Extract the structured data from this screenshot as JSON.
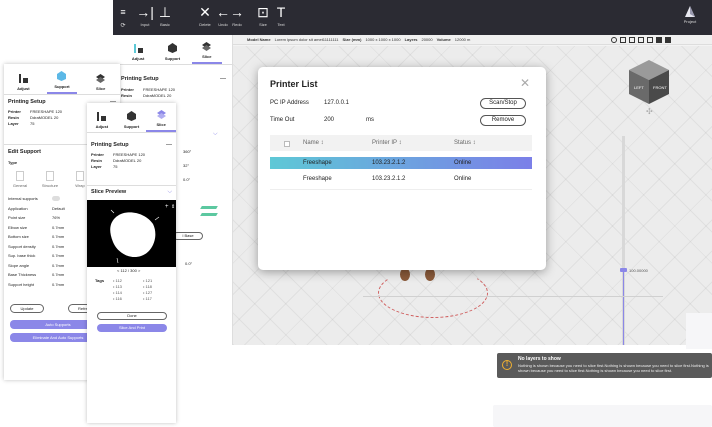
{
  "toolbar": {
    "items": [
      {
        "glyph": "≡",
        "label": ""
      },
      {
        "glyph": "→|",
        "label": "Input"
      },
      {
        "glyph": "⊥",
        "label": "Basic"
      },
      {
        "glyph": "✕",
        "label": "Delete"
      },
      {
        "glyph": "←",
        "label": "Undo"
      },
      {
        "glyph": "→",
        "label": "Redo"
      },
      {
        "glyph": "⊡",
        "label": "Size"
      },
      {
        "glyph": "T",
        "label": "Text"
      }
    ],
    "logo_label": "Project"
  },
  "infobar": {
    "model_name_key": "Model Name",
    "model_name_val": "Lorem ipsum dolor sit amet11111111",
    "size_key": "Size (mm)",
    "size_val": "1000 x 1000 x 1000",
    "layers_key": "Layers",
    "layers_val": "20000",
    "volume_key": "Volume",
    "volume_val": "12000 m"
  },
  "tabs": {
    "adjust": "Adjust",
    "support": "Support",
    "slice": "Slice"
  },
  "printing_setup": {
    "title": "Printing Setup",
    "printer_key": "Printer",
    "printer_val": "FREESHAPE 120",
    "resin_key": "Resin",
    "resin_val": "DdraMODEL 20",
    "layer_key": "Layer",
    "layer_val": "75"
  },
  "main_panel": {
    "rot_vals": [
      "360°",
      "32°",
      "0.0°"
    ],
    "base_label": "l Base",
    "extra_val": "0.0°"
  },
  "edit_support": {
    "title": "Edit Support",
    "type_label": "Type",
    "types": [
      "General",
      "Structure",
      "Wrap"
    ],
    "rows": [
      {
        "k": "Internal supports",
        "v": ""
      },
      {
        "k": "Application",
        "v": "Default"
      },
      {
        "k": "Point size",
        "v": "76%"
      },
      {
        "k": "Elbow size",
        "v": "0.7mm"
      },
      {
        "k": "Bottom size",
        "v": "0.7mm"
      },
      {
        "k": "Support density",
        "v": "0.7mm"
      },
      {
        "k": "Sup. base thick",
        "v": "0.7mm"
      },
      {
        "k": "Slope angle",
        "v": "0.7mm"
      },
      {
        "k": "Base Thickness",
        "v": "0.7mm"
      },
      {
        "k": "Support height",
        "v": "0.7mm"
      }
    ],
    "update_label": "Update",
    "refresh_label": "Refresh",
    "auto_supports_label": "Auto Supports",
    "eliminate_label": "Eliminate And Auto Supports"
  },
  "slice_preview": {
    "title": "Slice Preview",
    "pager": "< 112 / 300 >",
    "tags_label": "Tags",
    "tags": [
      "112",
      "113",
      "114",
      "116",
      "117",
      "118",
      "121",
      "127"
    ],
    "done_label": "Done",
    "slice_print_label": "Slice And Print"
  },
  "dialog": {
    "title": "Printer List",
    "ip_label": "PC IP Address",
    "ip_value": "127.0.0.1",
    "timeout_label": "Time Out",
    "timeout_value": "200",
    "timeout_unit": "ms",
    "scan_label": "Scan/Stop",
    "remove_label": "Remove",
    "columns": [
      "Name ↕",
      "Printer IP ↕",
      "Status ↕"
    ],
    "rows": [
      {
        "name": "Freeshape",
        "ip": "103.23.2.1.2",
        "status": "Online"
      },
      {
        "name": "Freeshape",
        "ip": "103.23.2.1.2",
        "status": "Online"
      }
    ]
  },
  "slider": {
    "value_label": "100.00000"
  },
  "toast": {
    "title": "No layers to show",
    "body": "Nothing is shown because you need to slice first.Nothing is shown because you need to slice first.Nothing is shown because you need to slice first.Nothing is shown because you need to slice first."
  },
  "colors": {
    "accent": "#8b87e8",
    "topbar": "#2b2b33",
    "row_selected_start": "#5ec8d6",
    "row_selected_end": "#7b7fe8"
  }
}
